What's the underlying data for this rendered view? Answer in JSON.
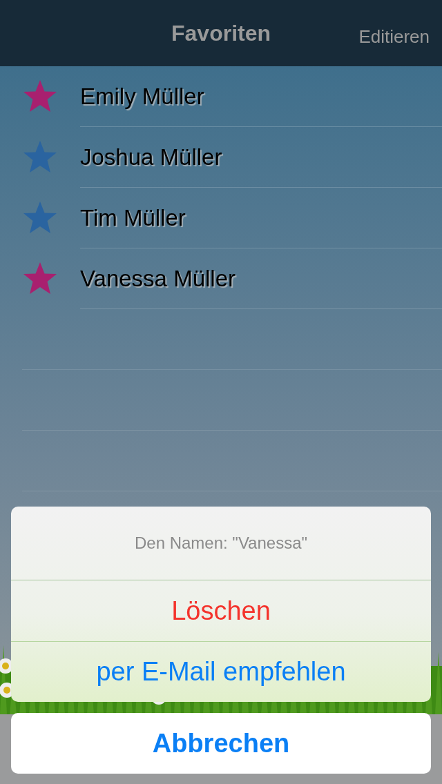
{
  "nav": {
    "title": "Favoriten",
    "edit": "Editieren"
  },
  "favorites": [
    {
      "name": "Emily Müller",
      "color": "#a8206f"
    },
    {
      "name": "Joshua Müller",
      "color": "#2a64a0"
    },
    {
      "name": "Tim Müller",
      "color": "#2a64a0"
    },
    {
      "name": "Vanessa Müller",
      "color": "#a8206f"
    }
  ],
  "action_sheet": {
    "title": "Den Namen: \"Vanessa\"",
    "actions": [
      {
        "label": "Löschen",
        "kind": "destructive"
      },
      {
        "label": "per E-Mail empfehlen",
        "kind": "default"
      }
    ],
    "cancel": "Abbrechen"
  }
}
